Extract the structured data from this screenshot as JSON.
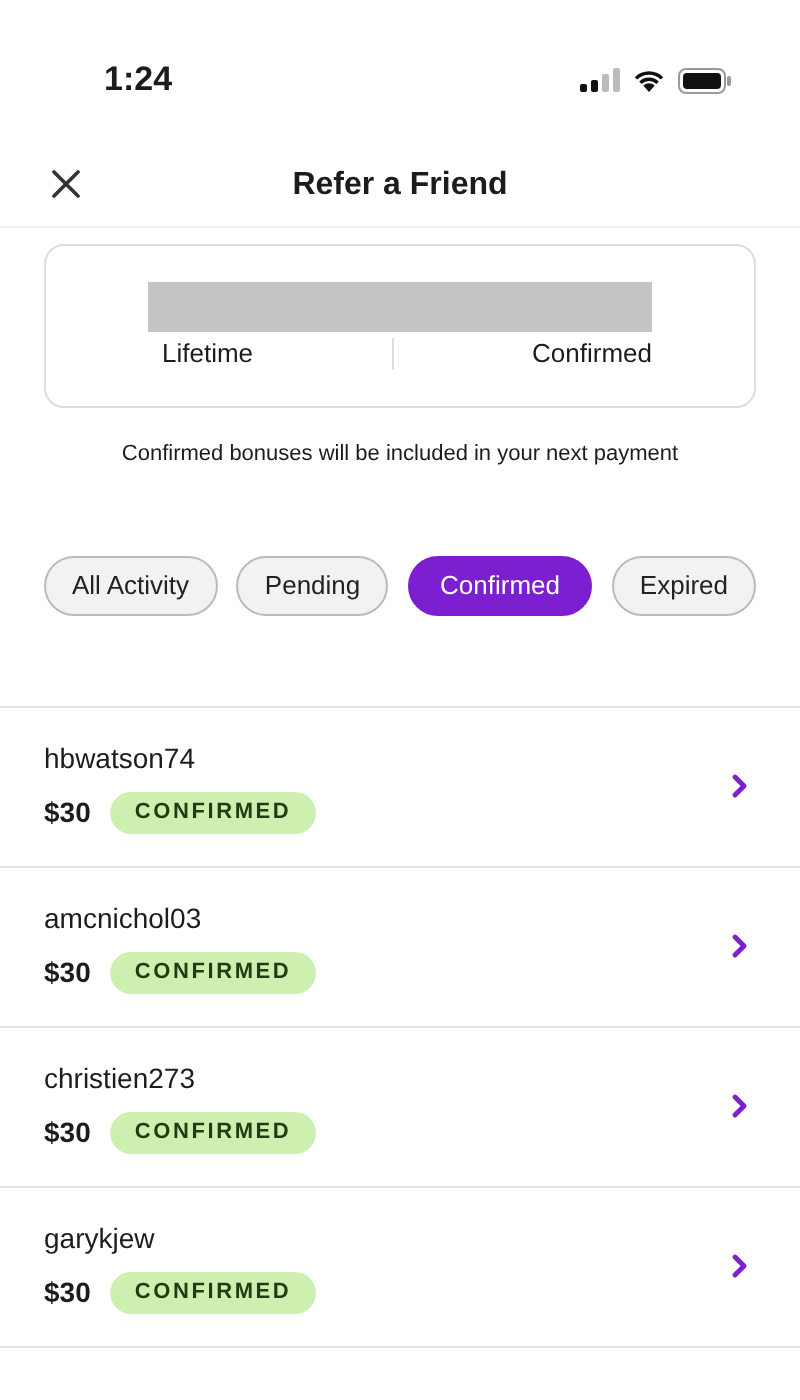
{
  "status_bar": {
    "time": "1:24"
  },
  "header": {
    "title": "Refer a Friend"
  },
  "summary": {
    "left_label": "Lifetime",
    "right_label": "Confirmed"
  },
  "note": "Confirmed bonuses will be included in your next payment",
  "filters": [
    {
      "label": "All Activity",
      "selected": false
    },
    {
      "label": "Pending",
      "selected": false
    },
    {
      "label": "Confirmed",
      "selected": true
    },
    {
      "label": "Expired",
      "selected": false
    }
  ],
  "referrals": [
    {
      "name": "hbwatson74",
      "amount": "$30",
      "status": "CONFIRMED"
    },
    {
      "name": "amcnichol03",
      "amount": "$30",
      "status": "CONFIRMED"
    },
    {
      "name": "christien273",
      "amount": "$30",
      "status": "CONFIRMED"
    },
    {
      "name": "garykjew",
      "amount": "$30",
      "status": "CONFIRMED"
    }
  ]
}
